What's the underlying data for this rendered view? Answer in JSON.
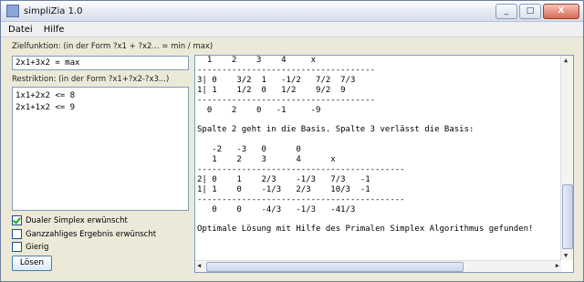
{
  "window": {
    "title": "simpliZia 1.0",
    "minimize": "_",
    "maximize": "□",
    "close": "X"
  },
  "menu": [
    "Datei",
    "Hilfe"
  ],
  "objective": {
    "label": "Zielfunktion: (in der Form ?x1 + ?x2... = min / max)",
    "value": "2x1+3x2 = max"
  },
  "constraints": {
    "label": "Restriktion: (in der Form ?x1+?x2-?x3...)",
    "value": "1x1+2x2 <= 8\n2x1+1x2 <= 9"
  },
  "options": [
    {
      "label": "Dualer Simplex erwünscht",
      "checked": true
    },
    {
      "label": "Ganzzahliges Ergebnis erwünscht",
      "checked": false
    },
    {
      "label": "Gierig",
      "checked": false
    }
  ],
  "solve_button": "Lösen",
  "output": {
    "text": "  1    2    3    4     x\n------------------------------------\n3| 0    3/2  1   -1/2   7/2  7/3\n1| 1    1/2  0   1/2    9/2  9\n------------------------------------\n  0    2    0   -1     -9\n\nSpalte 2 geht in die Basis. Spalte 3 verlässt die Basis:\n\n   -2   -3   0      0\n   1    2    3      4      x\n------------------------------------------\n2| 0    1    2/3    -1/3   7/3   -1\n1| 1    0    -1/3   2/3    10/3  -1\n------------------------------------------\n   0    0    -4/3   -1/3   -41/3\n\nOptimale Lösung mit Hilfe des Primalen Simplex Algorithmus gefunden!"
  }
}
